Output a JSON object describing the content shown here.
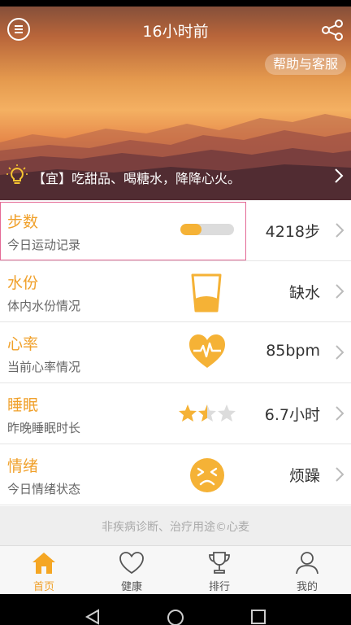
{
  "header": {
    "title": "16小时前",
    "help_label": "帮助与客服",
    "menu_icon": "menu-icon",
    "share_icon": "share-icon"
  },
  "tip": {
    "text": "【宜】吃甜品、喝糖水，降降心火。",
    "icon": "lightbulb-icon"
  },
  "colors": {
    "accent": "#f0a02a",
    "highlight_border": "#e46a96"
  },
  "rows": [
    {
      "title": "步数",
      "subtitle": "今日运动记录",
      "value": "4218步",
      "icon": "step-progress-bar",
      "progress": 0.4
    },
    {
      "title": "水份",
      "subtitle": "体内水份情况",
      "value": "缺水",
      "icon": "water-glass-icon"
    },
    {
      "title": "心率",
      "subtitle": "当前心率情况",
      "value": "85bpm",
      "icon": "heart-pulse-icon"
    },
    {
      "title": "睡眠",
      "subtitle": "昨晚睡眠时长",
      "value": "6.7小时",
      "icon": "star-rating",
      "rating": 1.5,
      "rating_max": 3
    },
    {
      "title": "情绪",
      "subtitle": "今日情绪状态",
      "value": "烦躁",
      "icon": "irritated-face-icon"
    }
  ],
  "disclaimer": "非疾病诊断、治疗用途©心麦",
  "tabs": [
    {
      "label": "首页",
      "icon": "home-icon",
      "active": true
    },
    {
      "label": "健康",
      "icon": "heart-outline-icon",
      "active": false
    },
    {
      "label": "排行",
      "icon": "trophy-icon",
      "active": false
    },
    {
      "label": "我的",
      "icon": "user-icon",
      "active": false
    }
  ],
  "system_nav": [
    "back-icon",
    "home-circle-icon",
    "recents-icon"
  ]
}
